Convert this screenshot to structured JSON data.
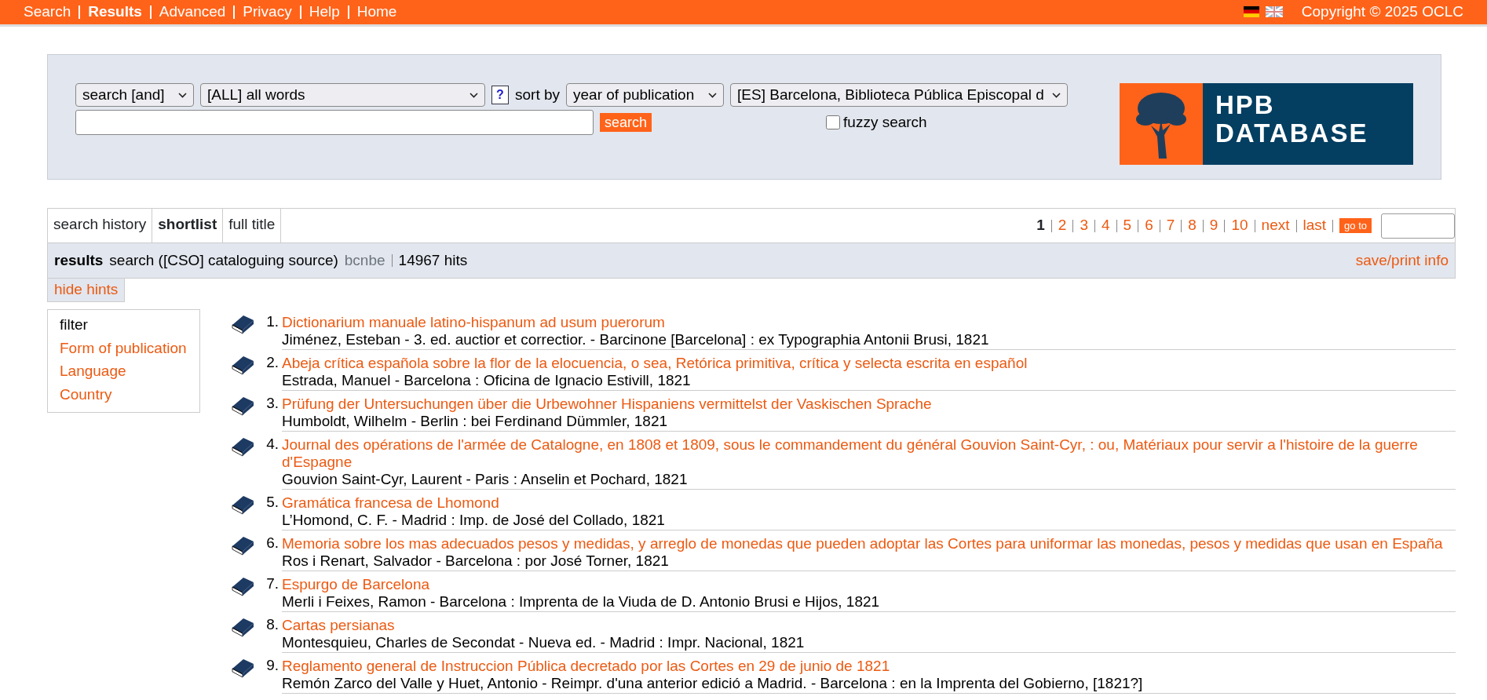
{
  "top_nav": {
    "items": [
      {
        "label": "Search",
        "selected": false
      },
      {
        "label": "Results",
        "selected": true
      },
      {
        "label": "Advanced",
        "selected": false
      },
      {
        "label": "Privacy",
        "selected": false
      },
      {
        "label": "Help",
        "selected": false
      },
      {
        "label": "Home",
        "selected": false
      }
    ],
    "copyright": "Copyright © 2025 OCLC"
  },
  "search_form": {
    "operator": "search [and]",
    "index": "[ALL] all words",
    "help": "?",
    "sort_label": "sort by",
    "sort": "year of publication",
    "library": "[ES] Barcelona, Biblioteca Pública Episcopal d",
    "button": "search",
    "fuzzy": {
      "label": "fuzzy search",
      "checked": false
    }
  },
  "logo": {
    "line_1": "HPB",
    "line_2": "DATABASE"
  },
  "view_tabs": [
    {
      "label": "search history",
      "selected": false
    },
    {
      "label": "shortlist",
      "selected": true
    },
    {
      "label": "full title",
      "selected": false
    }
  ],
  "pagination": {
    "pages": [
      {
        "label": "1",
        "selected": true
      },
      {
        "label": "2",
        "selected": false
      },
      {
        "label": "3",
        "selected": false
      },
      {
        "label": "4",
        "selected": false
      },
      {
        "label": "5",
        "selected": false
      },
      {
        "label": "6",
        "selected": false
      },
      {
        "label": "7",
        "selected": false
      },
      {
        "label": "8",
        "selected": false
      },
      {
        "label": "9",
        "selected": false
      },
      {
        "label": "10",
        "selected": false
      },
      {
        "label": "next",
        "selected": false
      },
      {
        "label": "last",
        "selected": false
      }
    ],
    "go_to": "go to"
  },
  "results_bar": {
    "label": "results",
    "query": "search ([CSO] cataloguing source)",
    "code": "bcnbe",
    "hits": "14967 hits",
    "save": "save/print info"
  },
  "hide_hints": "hide hints",
  "filter": {
    "title": "filter",
    "items": [
      "Form of publication",
      "Language",
      "Country"
    ]
  },
  "records": [
    {
      "number": "1.",
      "title": "Dictionarium manuale latino-hispanum ad usum puerorum",
      "details": "Jiménez, Esteban - 3. ed. auctior et correctior. - Barcinone [Barcelona] : ex Typographia Antonii Brusi, 1821"
    },
    {
      "number": "2.",
      "title": "Abeja crítica española sobre la flor de la elocuencia, o sea, Retórica primitiva, crítica y selecta escrita en español",
      "details": "Estrada, Manuel - Barcelona : Oficina de Ignacio Estivill, 1821"
    },
    {
      "number": "3.",
      "title": "Prüfung der Untersuchungen über die Urbewohner Hispaniens vermittelst der Vaskischen Sprache",
      "details": "Humboldt, Wilhelm - Berlin : bei Ferdinand Dümmler, 1821"
    },
    {
      "number": "4.",
      "title": "Journal des opérations de l'armée de Catalogne, en 1808 et 1809, sous le commandement du général Gouvion Saint-Cyr, : ou, Matériaux pour servir a l'histoire de la guerre d'Espagne",
      "details": "Gouvion Saint-Cyr, Laurent - Paris : Anselin et Pochard, 1821"
    },
    {
      "number": "5.",
      "title": "Gramática francesa de Lhomond",
      "details": "L’Homond, C. F. - Madrid : Imp. de José del Collado, 1821"
    },
    {
      "number": "6.",
      "title": "Memoria sobre los mas adecuados pesos y medidas, y arreglo de monedas que pueden adoptar las Cortes para uniformar las monedas, pesos y medidas que usan en España",
      "details": "Ros i Renart, Salvador - Barcelona : por José Torner, 1821"
    },
    {
      "number": "7.",
      "title": "Espurgo de Barcelona",
      "details": "Merli i Feixes, Ramon - Barcelona : Imprenta de la Viuda de D. Antonio Brusi e Hijos, 1821"
    },
    {
      "number": "8.",
      "title": "Cartas persianas",
      "details": "Montesquieu, Charles de Secondat - Nueva ed. - Madrid : Impr. Nacional, 1821"
    },
    {
      "number": "9.",
      "title": "Reglamento general de Instruccion Pública decretado por las Cortes en 29 de junio de 1821",
      "details": "Remón Zarco del Valle y Huet, Antonio - Reimpr. d'una anterior edició a Madrid. - Barcelona : en la Imprenta del Gobierno, [1821?]"
    }
  ]
}
